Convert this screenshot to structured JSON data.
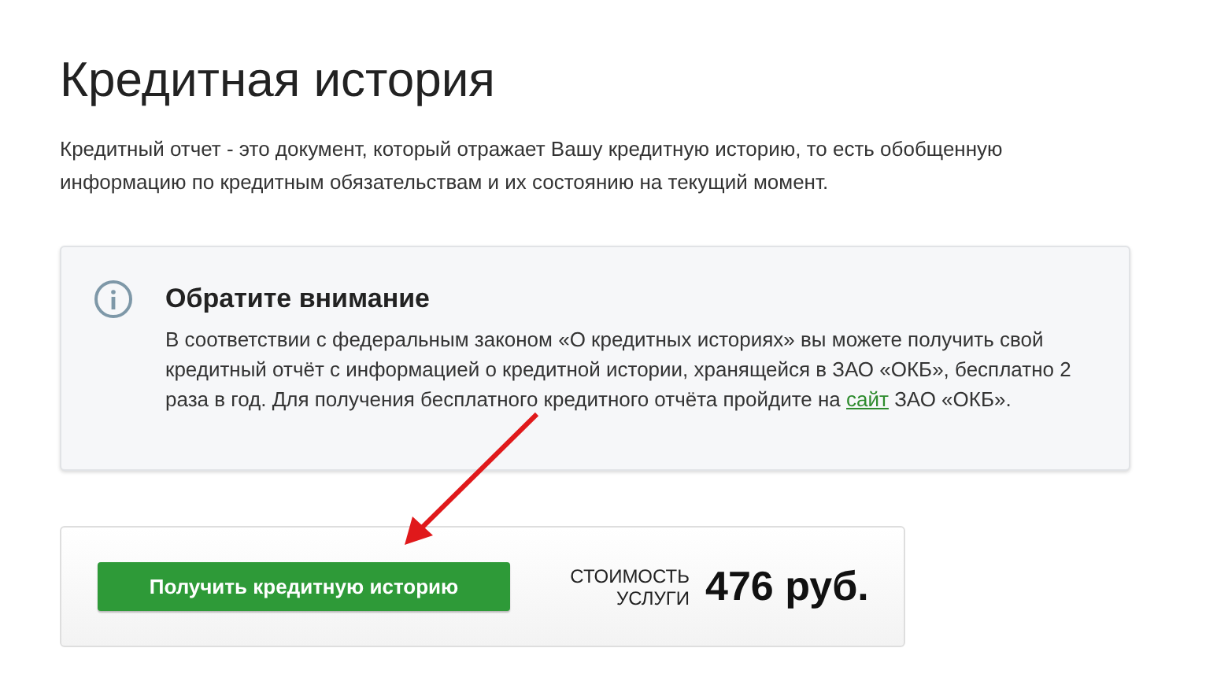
{
  "title": "Кредитная история",
  "description": "Кредитный отчет - это документ, который отражает Вашу кредитную историю, то есть обобщенную информацию по кредитным обязательствам и их состоянию на текущий момент.",
  "notice": {
    "heading": "Обратите внимание",
    "text_before": "В соответствии с федеральным законом «О кредитных историях» вы можете получить свой кредитный отчёт с информацией о кредитной истории, хранящейся в ЗАО «ОКБ», бесплатно 2 раза в год. Для получения бесплатного кредитного отчёта пройдите на ",
    "link": "сайт",
    "text_after": " ЗАО «ОКБ»."
  },
  "purchase": {
    "button": "Получить кредитную историю",
    "price_label": "СТОИМОСТЬ УСЛУГИ",
    "price": "476 руб."
  }
}
